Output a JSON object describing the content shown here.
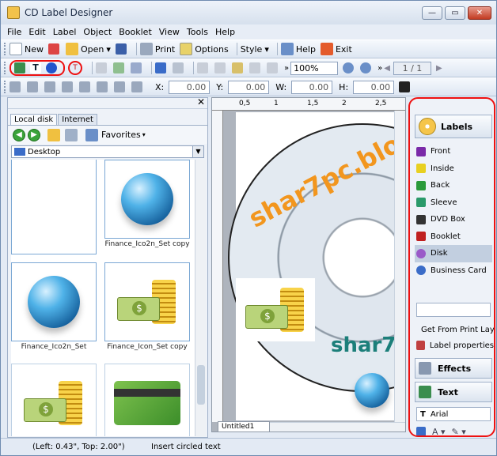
{
  "window": {
    "title": "CD Label Designer"
  },
  "menu": [
    "File",
    "Edit",
    "Label",
    "Object",
    "Booklet",
    "View",
    "Tools",
    "Help"
  ],
  "toolbar1": {
    "new": "New",
    "open": "Open",
    "print": "Print",
    "options": "Options",
    "style": "Style",
    "help": "Help",
    "exit": "Exit"
  },
  "toolbar2": {
    "zoom": "100%",
    "page": "1 / 1"
  },
  "toolbar3": {
    "x_label": "X:",
    "x_value": "0.00",
    "y_label": "Y:",
    "y_value": "0.00",
    "w_label": "W:",
    "w_value": "0.00",
    "h_label": "H:",
    "h_value": "0.00"
  },
  "left_panel": {
    "tabs": [
      "Local disk",
      "Internet"
    ],
    "favorites": "Favorites",
    "path": "Desktop",
    "files": [
      {
        "name": "",
        "type": "blank"
      },
      {
        "name": "Finance_Ico2n_Set copy",
        "type": "globe"
      },
      {
        "name": "Finance_Ico2n_Set",
        "type": "globe"
      },
      {
        "name": "Finance_Icon_Set copy",
        "type": "money"
      },
      {
        "name": "",
        "type": "money"
      },
      {
        "name": "",
        "type": "card"
      }
    ]
  },
  "ruler": {
    "ticks": [
      "0,5",
      "1",
      "1,5",
      "2",
      "2,5"
    ]
  },
  "canvas": {
    "watermark_orange": "shar7pc.blo",
    "watermark_blue": "shar7",
    "doc_tab": "Untitled1"
  },
  "right_panel": {
    "labels_header": "Labels",
    "label_items": [
      "Front",
      "Inside",
      "Back",
      "Sleeve",
      "DVD Box",
      "Booklet",
      "Disk",
      "Business Card"
    ],
    "selected_index": 6,
    "links": [
      "Get From Print Lay",
      "Label properties"
    ],
    "effects_header": "Effects",
    "text_header": "Text",
    "font": "Arial"
  },
  "status": {
    "position": "(Left: 0.43\", Top: 2.00\")",
    "message": "Insert circled text"
  }
}
